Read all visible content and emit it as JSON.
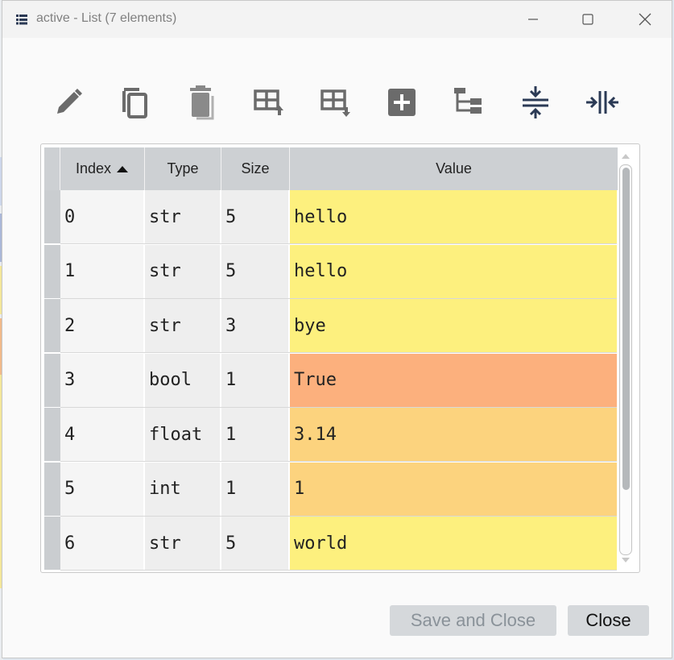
{
  "window": {
    "title": "active - List (7 elements)"
  },
  "toolbar": {
    "buttons": [
      {
        "icon": "edit-icon"
      },
      {
        "icon": "copy-icon"
      },
      {
        "icon": "delete-icon"
      },
      {
        "icon": "insert-above-icon"
      },
      {
        "icon": "insert-below-icon"
      },
      {
        "icon": "add-icon"
      },
      {
        "icon": "tree-view-icon"
      },
      {
        "icon": "collapse-rows-icon"
      },
      {
        "icon": "collapse-columns-icon"
      }
    ]
  },
  "table": {
    "columns": [
      "Index",
      "Type",
      "Size",
      "Value"
    ],
    "sort_column": "Index",
    "sort_direction": "ascending",
    "rows": [
      {
        "index": "0",
        "type": "str",
        "size": "5",
        "value": "hello",
        "color": "#fdf07e"
      },
      {
        "index": "1",
        "type": "str",
        "size": "5",
        "value": "hello",
        "color": "#fdf07e"
      },
      {
        "index": "2",
        "type": "str",
        "size": "3",
        "value": "bye",
        "color": "#fdf07e"
      },
      {
        "index": "3",
        "type": "bool",
        "size": "1",
        "value": "True",
        "color": "#fcb07d"
      },
      {
        "index": "4",
        "type": "float",
        "size": "1",
        "value": "3.14",
        "color": "#fcd37e"
      },
      {
        "index": "5",
        "type": "int",
        "size": "1",
        "value": "1",
        "color": "#fcd37e"
      },
      {
        "index": "6",
        "type": "str",
        "size": "5",
        "value": "world",
        "color": "#fdf07e"
      }
    ]
  },
  "footer": {
    "save_label": "Save and Close",
    "close_label": "Close"
  },
  "colors": {
    "header_bg": "#cdd0d3",
    "disabled_text": "#8a9299"
  }
}
